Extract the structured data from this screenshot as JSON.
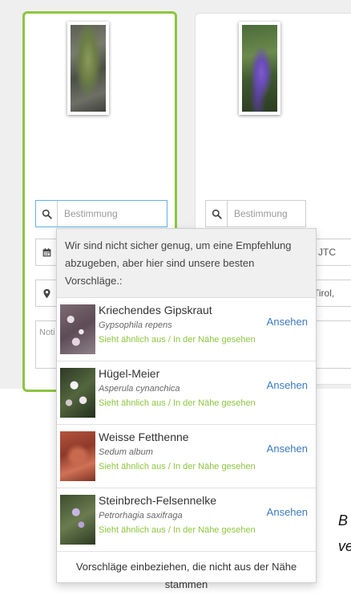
{
  "search": {
    "placeholder": "Bestimmung"
  },
  "card2": {
    "time_suffix": "JTC",
    "location_suffix": "Tirol,"
  },
  "card1": {
    "notes_placeholder": "Noti"
  },
  "dropdown": {
    "header": "Wir sind nicht sicher genug, um eine Empfehlung abzugeben, aber hier sind unsere besten Vorschläge.:",
    "suggestions": [
      {
        "name": "Kriechendes Gipskraut",
        "scientific": "Gypsophila repens",
        "hint": "Sieht ähnlich aus / In der Nähe gesehen",
        "action": "Ansehen"
      },
      {
        "name": "Hügel-Meier",
        "scientific": "Asperula cynanchica",
        "hint": "Sieht ähnlich aus / In der Nähe gesehen",
        "action": "Ansehen"
      },
      {
        "name": "Weisse Fetthenne",
        "scientific": "Sedum album",
        "hint": "Sieht ähnlich aus / In der Nähe gesehen",
        "action": "Ansehen"
      },
      {
        "name": "Steinbrech-Felsennelke",
        "scientific": "Petrorhagia saxifraga",
        "hint": "Sieht ähnlich aus / In der Nähe gesehen",
        "action": "Ansehen"
      }
    ],
    "footer": "Vorschläge einbeziehen, die nicht aus der Nähe stammen"
  },
  "side": {
    "line1": "B",
    "line2": "ve"
  },
  "colors": {
    "accent_green": "#8cc63f",
    "link_blue": "#3a7abf",
    "focus_blue": "#66afe9"
  },
  "icons": {
    "search": "search-icon",
    "calendar": "calendar-icon",
    "location": "map-marker-icon"
  }
}
